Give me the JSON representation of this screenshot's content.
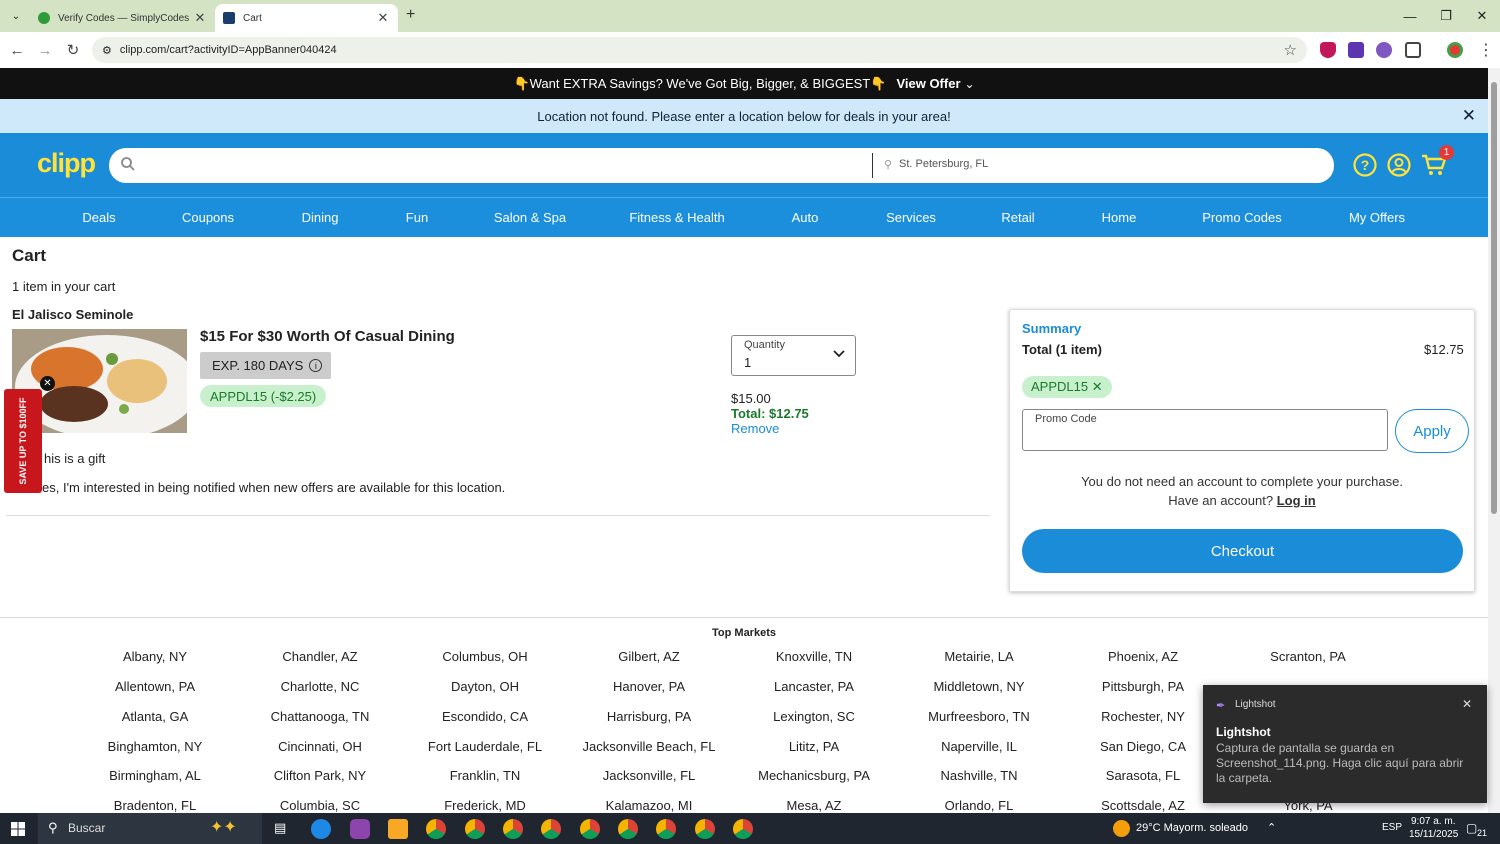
{
  "browser": {
    "tabs": [
      {
        "title": "Verify Codes — SimplyCodes",
        "close": "✕"
      },
      {
        "title": "Cart",
        "close": "✕"
      }
    ],
    "new_tab": "+",
    "url": "clipp.com/cart?activityID=AppBanner040424"
  },
  "site": {
    "promo_banner": "👇Want EXTRA Savings? We've Got Big, Bigger, & BIGGEST👇",
    "promo_link": "View Offer",
    "location_notice": "Location not found. Please enter a location below for deals in your area!",
    "logo": "clipp",
    "search_placeholder": "",
    "location_value": "St. Petersburg, FL",
    "cart_count": "1",
    "menu": [
      "Deals",
      "Coupons",
      "Dining",
      "Fun",
      "Salon & Spa",
      "Fitness & Health",
      "Auto",
      "Services",
      "Retail",
      "Home",
      "Promo Codes",
      "My Offers"
    ]
  },
  "cart": {
    "title": "Cart",
    "count_text": "1 item in your cart",
    "merchant": "El Jalisco Seminole",
    "item_title": "$15 For $30 Worth Of Casual Dining",
    "expiry": "EXP. 180 DAYS",
    "coupon_tag": "APPDL15 (-$2.25)",
    "quantity_label": "Quantity",
    "quantity_value": "1",
    "price": "$15.00",
    "total": "Total: $12.75",
    "remove": "Remove",
    "gift_text": "his is a gift",
    "notify_text": "es, I'm interested in being notified when new offers are available for this location.",
    "side_flag": "SAVE UP TO $100FF"
  },
  "summary": {
    "title": "Summary",
    "total_label": "Total (1 item)",
    "total_value": "$12.75",
    "applied_code": "APPDL15 ✕",
    "promo_label": "Promo Code",
    "apply": "Apply",
    "account_note": "You do not need an account to complete your purchase.",
    "have_account": "Have an account?",
    "login": "Log in",
    "checkout": "Checkout"
  },
  "markets": {
    "title": "Top Markets",
    "columns": [
      [
        "Albany, NY",
        "Allentown, PA",
        "Atlanta, GA",
        "Binghamton, NY",
        "Birmingham, AL",
        "Bradenton, FL"
      ],
      [
        "Chandler, AZ",
        "Charlotte, NC",
        "Chattanooga, TN",
        "Cincinnati, OH",
        "Clifton Park, NY",
        "Columbia, SC"
      ],
      [
        "Columbus, OH",
        "Dayton, OH",
        "Escondido, CA",
        "Fort Lauderdale, FL",
        "Franklin, TN",
        "Frederick, MD"
      ],
      [
        "Gilbert, AZ",
        "Hanover, PA",
        "Harrisburg, PA",
        "Jacksonville Beach, FL",
        "Jacksonville, FL",
        "Kalamazoo, MI"
      ],
      [
        "Knoxville, TN",
        "Lancaster, PA",
        "Lexington, SC",
        "Lititz, PA",
        "Mechanicsburg, PA",
        "Mesa, AZ"
      ],
      [
        "Metairie, LA",
        "Middletown, NY",
        "Murfreesboro, TN",
        "Naperville, IL",
        "Nashville, TN",
        "Orlando, FL"
      ],
      [
        "Phoenix, AZ",
        "Pittsburgh, PA",
        "Rochester, NY",
        "San Diego, CA",
        "Sarasota, FL",
        "Scottsdale, AZ"
      ],
      [
        "Scranton, PA",
        "",
        "",
        "",
        "",
        "York, PA"
      ]
    ]
  },
  "toast": {
    "app": "Lightshot",
    "title": "Lightshot",
    "message": "Captura de pantalla se guarda en Screenshot_114.png. Haga clic aquí para abrir la carpeta.",
    "close": "✕"
  },
  "taskbar": {
    "search": "Buscar",
    "weather": "29°C  Mayorm. soleado",
    "lang": "ESP",
    "time": "9:07 a. m.",
    "date": "15/11/2025",
    "notif": "21"
  },
  "colors": {
    "brand_blue": "#1a8cd8",
    "logo_yellow": "#ffe23a",
    "tag_green": "#c9f0cd",
    "flag_red": "#c8161d"
  }
}
